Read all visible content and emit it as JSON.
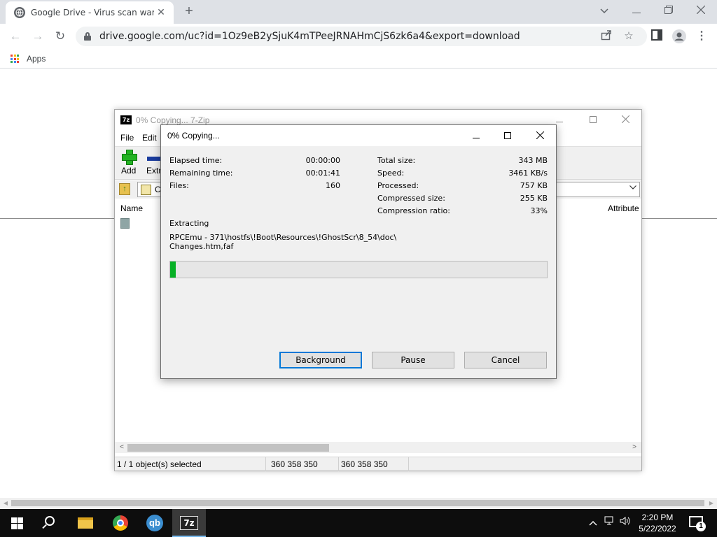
{
  "browser": {
    "tab_title": "Google Drive - Virus scan warnin",
    "url": "drive.google.com/uc?id=1Oz9eB2ySjuK4mTPeeJRNAHmCjS6zk6a4&export=download",
    "bookmarks": {
      "apps_label": "Apps"
    }
  },
  "sevenzip": {
    "title": "0% Copying... 7-Zip",
    "menu": [
      "File",
      "Edit"
    ],
    "toolbar": {
      "add_label": "Add",
      "extract_label": "Extr"
    },
    "address_text": "C",
    "columns": {
      "name": "Name",
      "attributes": "Attribute"
    },
    "status": {
      "selected": "1 / 1 object(s) selected",
      "size1": "360 358 350",
      "size2": "360 358 350"
    }
  },
  "progress": {
    "title": "0% Copying...",
    "left_stats": [
      {
        "label": "Elapsed time:",
        "value": "00:00:00"
      },
      {
        "label": "Remaining time:",
        "value": "00:01:41"
      },
      {
        "label": "Files:",
        "value": "160"
      }
    ],
    "right_stats": [
      {
        "label": "Total size:",
        "value": "343 MB"
      },
      {
        "label": "Speed:",
        "value": "3461 KB/s"
      },
      {
        "label": "Processed:",
        "value": "757 KB"
      },
      {
        "label": "Compressed size:",
        "value": "255 KB"
      },
      {
        "label": "Compression ratio:",
        "value": "33%"
      }
    ],
    "action_label": "Extracting",
    "path_line1": "RPCEmu - 371\\hostfs\\!Boot\\Resources\\!GhostScr\\8_54\\doc\\",
    "path_line2": "Changes.htm,faf",
    "progress_fraction": 0.015,
    "buttons": {
      "background": "Background",
      "pause": "Pause",
      "cancel": "Cancel"
    }
  },
  "taskbar": {
    "time": "2:20 PM",
    "date": "5/22/2022",
    "notification_count": "1"
  },
  "colors": {
    "progress_fill": "#06b025",
    "default_button_border": "#0078d7",
    "taskbar": "#0d0d0d"
  }
}
